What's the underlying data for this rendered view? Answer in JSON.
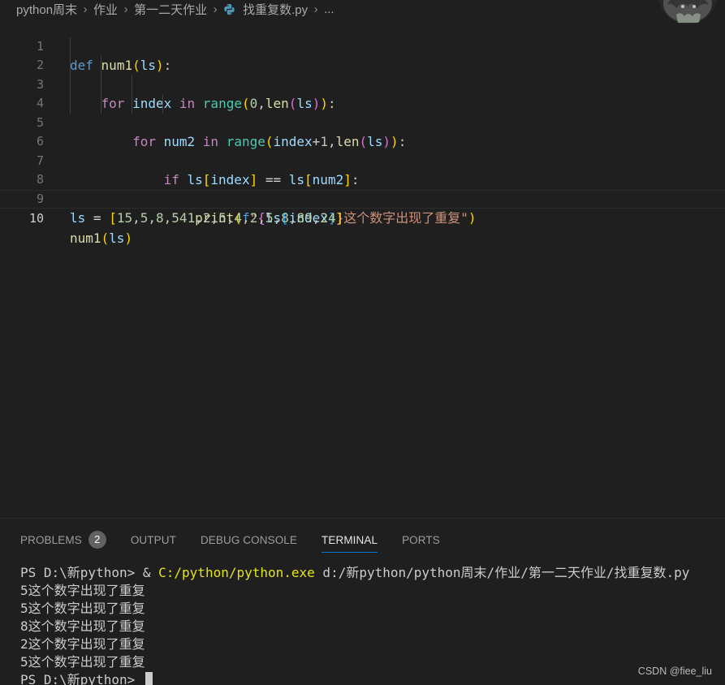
{
  "breadcrumb": {
    "items": [
      "python周末",
      "作业",
      "第一二天作业"
    ],
    "file": "找重复数.py",
    "ellipsis": "..."
  },
  "editor": {
    "line_numbers": [
      "1",
      "2",
      "3",
      "4",
      "5",
      "6",
      "7",
      "8",
      "9",
      "10"
    ],
    "current_line": "10"
  },
  "panel": {
    "tabs": [
      {
        "label": "PROBLEMS",
        "badge": "2"
      },
      {
        "label": "OUTPUT"
      },
      {
        "label": "DEBUG CONSOLE"
      },
      {
        "label": "TERMINAL"
      },
      {
        "label": "PORTS"
      }
    ],
    "active_tab": "TERMINAL"
  },
  "terminal": {
    "prompt": "PS D:\\新python> ",
    "cmd_amp": "& ",
    "cmd_exe": "C:/python/python.exe",
    "cmd_arg": " d:/新python/python周末/作业/第一二天作业/找重复数.py",
    "output": [
      "5这个数字出现了重复",
      "5这个数字出现了重复",
      "8这个数字出现了重复",
      "2这个数字出现了重复",
      "5这个数字出现了重复"
    ],
    "final_prompt": "PS D:\\新python> "
  },
  "watermark": "CSDN @fiee_liu",
  "icons": [
    "chevron-right-icon",
    "python-file-icon",
    "user-avatar"
  ],
  "colors": {
    "background": "#1f1f1f",
    "keyword": "#569cd6",
    "control": "#c586c0",
    "function": "#dcdcaa",
    "variable": "#9cdcfe",
    "number": "#b5cea8",
    "string": "#ce9178",
    "terminal_exe": "#e5e510",
    "tab_active_underline": "#0078d4"
  }
}
